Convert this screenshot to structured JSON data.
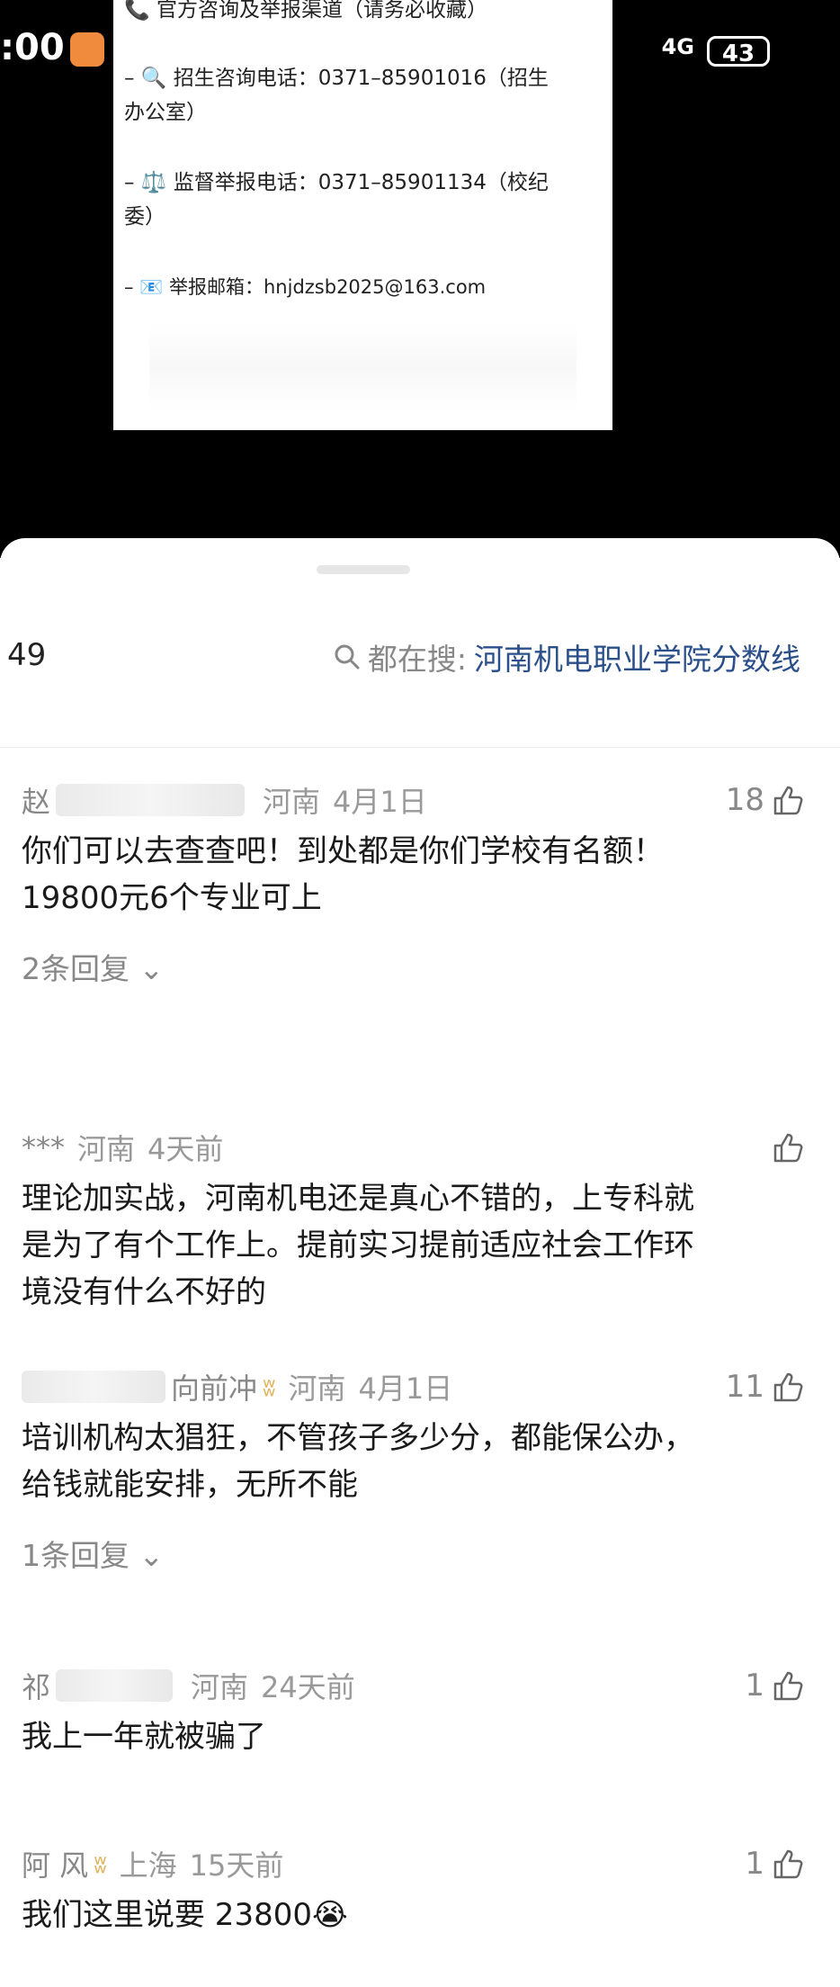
{
  "status_bar": {
    "time": ":00",
    "network": "4G",
    "battery": "43"
  },
  "notice_card": {
    "heading": "📞 官方咨询及举报渠道（请务必收藏）",
    "lines": [
      "– 🔍 招生咨询电话：0371–85901016（招生",
      "办公室）",
      "– ⚖️ 监督举报电话：0371–85901134（校纪",
      "委）",
      "– 📧 举报邮箱：hnjdzsb2025@163.com"
    ]
  },
  "sheet": {
    "comment_count": "49",
    "search_prefix": "都在搜:",
    "search_term": "河南机电职业学院分数线"
  },
  "comments": [
    {
      "user": "赵",
      "region": "河南",
      "time": "4月1日",
      "likes": "18",
      "lines": [
        "你们可以去查查吧！到处都是你们学校有名额！",
        "19800元6个专业可上"
      ],
      "replies": "2条回复"
    },
    {
      "user": "***",
      "region": "河南",
      "time": "4天前",
      "likes": "",
      "lines": [
        "理论加实战，河南机电还是真心不错的，上专科就",
        "是为了有个工作上。提前实习提前适应社会工作环",
        "境没有什么不好的"
      ],
      "replies": ""
    },
    {
      "user": "向前冲",
      "region": "河南",
      "time": "4月1日",
      "likes": "11",
      "lines": [
        "培训机构太猖狂，不管孩子多少分，都能保公办，",
        "给钱就能安排，无所不能"
      ],
      "replies": "1条回复"
    },
    {
      "user": "祁",
      "region": "河南",
      "time": "24天前",
      "likes": "1",
      "lines": [
        "我上一年就被骗了"
      ],
      "replies": ""
    },
    {
      "user": "阿 风",
      "region": "上海",
      "time": "15天前",
      "likes": "1",
      "lines": [
        "我们这里说要 23800😭"
      ],
      "replies": ""
    }
  ]
}
